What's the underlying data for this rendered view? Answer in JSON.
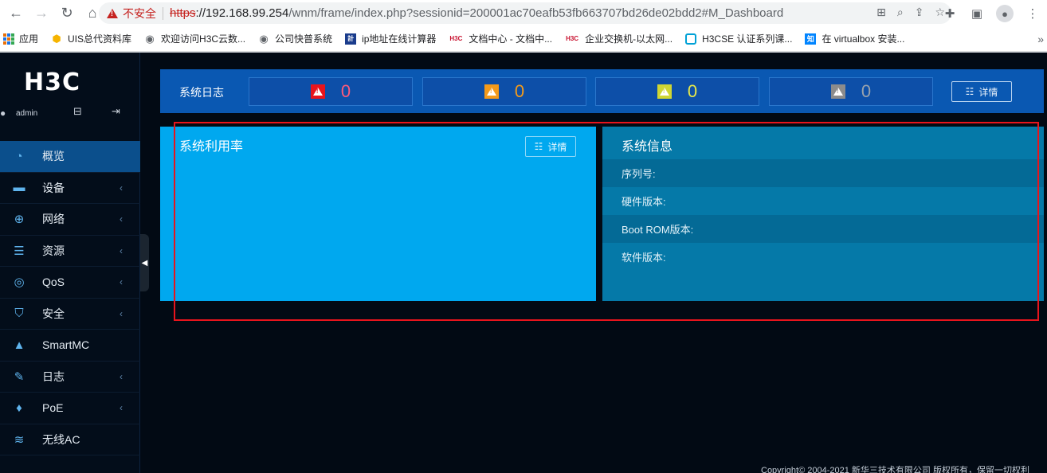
{
  "browser": {
    "security_label": "不安全",
    "url_proto": "https",
    "url_host": "://192.168.99.254",
    "url_path": "/wnm/frame/index.php?sessionid=200001ac70eafb53fb663707bd26de02bdd2#M_Dashboard",
    "bookmarks": [
      {
        "label": "应用",
        "icon": "apps-grid-icon"
      },
      {
        "label": "UIS总代资料库",
        "icon": "hexagon-icon",
        "color": "#f6b400"
      },
      {
        "label": "欢迎访问H3C云数...",
        "icon": "globe-icon",
        "color": "#5f6368"
      },
      {
        "label": "公司快普系统",
        "icon": "globe-icon",
        "color": "#5f6368"
      },
      {
        "label": "ip地址在线计算器",
        "icon": "calc-icon",
        "color": "#1a3c8c"
      },
      {
        "label": "文档中心 - 文档中...",
        "icon": "h3c-icon",
        "color": "#c8102e"
      },
      {
        "label": "企业交换机-以太网...",
        "icon": "h3c-icon",
        "color": "#c8102e"
      },
      {
        "label": "H3CSE 认证系列课...",
        "icon": "tv-icon",
        "color": "#00a1d6"
      },
      {
        "label": "在 virtualbox 安装...",
        "icon": "zhihu-icon",
        "color": "#0084ff"
      }
    ]
  },
  "app": {
    "logo": "H3C",
    "user": "admin",
    "menu": [
      {
        "label": "概览",
        "icon": "gauge-icon",
        "active": true,
        "has_arrow": false
      },
      {
        "label": "设备",
        "icon": "device-icon",
        "has_arrow": true
      },
      {
        "label": "网络",
        "icon": "globe-icon",
        "has_arrow": true
      },
      {
        "label": "资源",
        "icon": "database-icon",
        "has_arrow": true
      },
      {
        "label": "QoS",
        "icon": "qos-icon",
        "has_arrow": true
      },
      {
        "label": "安全",
        "icon": "shield-icon",
        "has_arrow": true
      },
      {
        "label": "SmartMC",
        "icon": "smartmc-icon",
        "has_arrow": false
      },
      {
        "label": "日志",
        "icon": "log-icon",
        "has_arrow": true
      },
      {
        "label": "PoE",
        "icon": "poe-icon",
        "has_arrow": true
      },
      {
        "label": "无线AC",
        "icon": "wifi-icon",
        "has_arrow": false
      }
    ],
    "menu_arrow": "‹",
    "system_log": {
      "title": "系统日志",
      "levels": [
        {
          "name": "critical",
          "count": "0",
          "icon_color": "#e8141c",
          "count_color": "#ff5a7a"
        },
        {
          "name": "major",
          "count": "0",
          "icon_color": "#f39a1a",
          "count_color": "#f39a1a"
        },
        {
          "name": "minor",
          "count": "0",
          "icon_color": "#cfd633",
          "count_color": "#e6e84a"
        },
        {
          "name": "info",
          "count": "0",
          "icon_color": "#8c8c8c",
          "count_color": "#9aa3ad"
        }
      ],
      "detail_label": "详情"
    },
    "usage": {
      "title": "系统利用率",
      "detail_label": "详情"
    },
    "sysinfo": {
      "title": "系统信息",
      "rows": [
        "序列号:",
        "硬件版本:",
        "Boot ROM版本:",
        "软件版本:"
      ]
    },
    "copyright": "Copyright© 2004-2021 新华三技术有限公司 版权所有，保留一切权利"
  }
}
